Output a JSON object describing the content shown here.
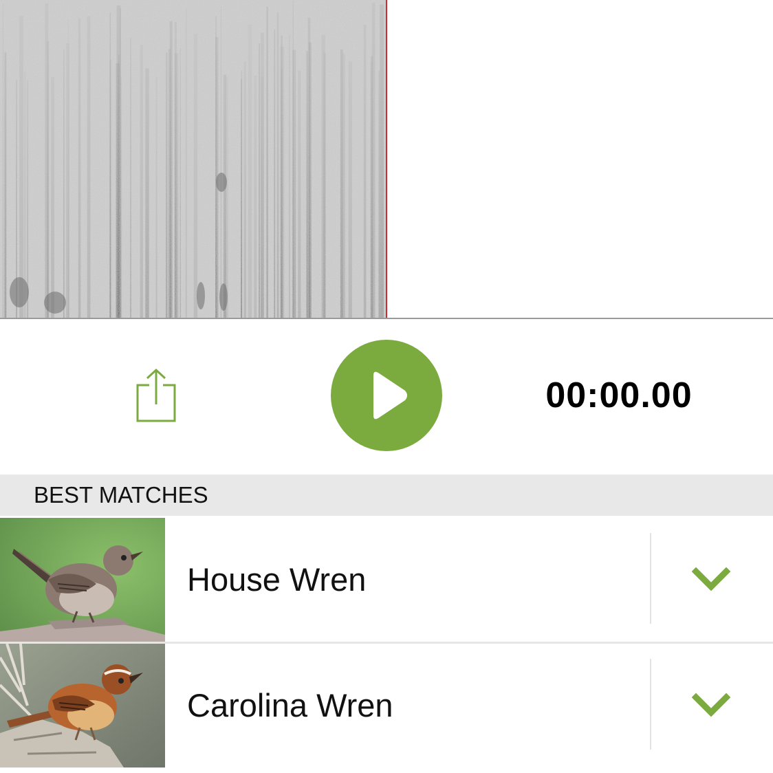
{
  "player": {
    "time": "00:00.00",
    "accent_color": "#7bab3f",
    "playhead_color": "#d6262e",
    "play_icon": "play-icon",
    "share_icon": "share-icon"
  },
  "matches": {
    "header": "BEST MATCHES",
    "items": [
      {
        "name": "House Wren",
        "expand_icon": "chevron-down-icon"
      },
      {
        "name": "Carolina Wren",
        "expand_icon": "chevron-down-icon"
      }
    ]
  }
}
